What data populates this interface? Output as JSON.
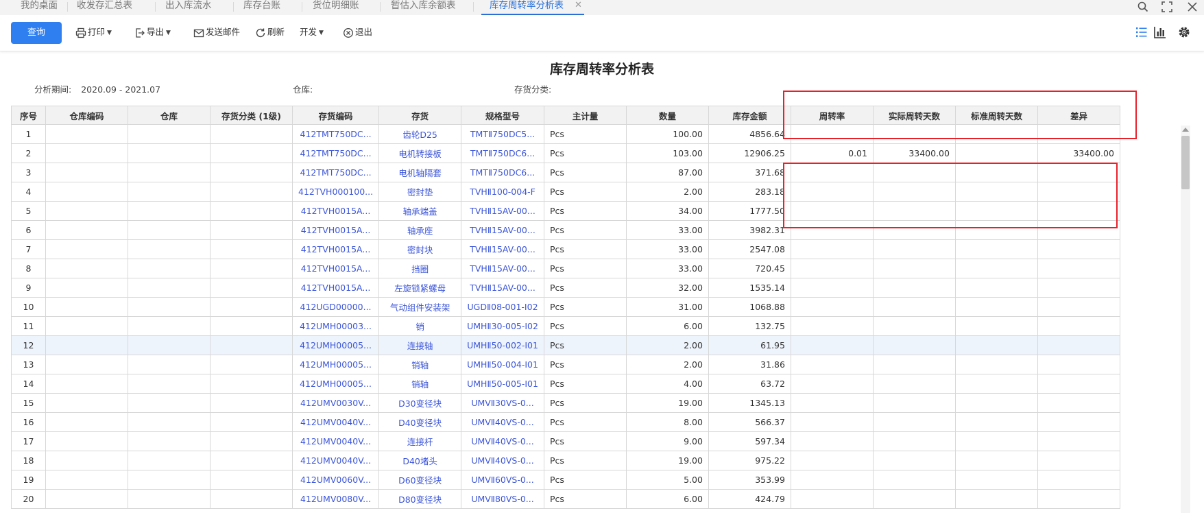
{
  "tabs": [
    {
      "label": "我的桌面"
    },
    {
      "label": "收发存汇总表"
    },
    {
      "label": "出入库流水"
    },
    {
      "label": "库存台账"
    },
    {
      "label": "货位明细账"
    },
    {
      "label": "暂估入库余额表"
    },
    {
      "label": "库存周转率分析表",
      "active": true
    }
  ],
  "toolbar": {
    "query_label": "查询",
    "print_label": "打印",
    "export_label": "导出",
    "mail_label": "发送邮件",
    "refresh_label": "刷新",
    "develop_label": "开发",
    "exit_label": "退出"
  },
  "report": {
    "title": "库存周转率分析表",
    "period_label": "分析期间:",
    "period_value": "2020.09 - 2021.07",
    "warehouse_label": "仓库:",
    "category_label": "存货分类:"
  },
  "table": {
    "columns": [
      "序号",
      "仓库编码",
      "仓库",
      "存货分类 (1级)",
      "存货编码",
      "存货",
      "规格型号",
      "主计量",
      "数量",
      "库存金额",
      "周转率",
      "实际周转天数",
      "标准周转天数",
      "差异"
    ],
    "rows": [
      [
        "1",
        "",
        "",
        "",
        "412TMT750DC...",
        "齿轮D25",
        "TMTⅡ750DC5...",
        "Pcs",
        "100.00",
        "4856.64",
        "",
        "",
        "",
        ""
      ],
      [
        "2",
        "",
        "",
        "",
        "412TMT750DC...",
        "电机转接板",
        "TMTⅡ750DC6...",
        "Pcs",
        "103.00",
        "12906.25",
        "0.01",
        "33400.00",
        "",
        "33400.00"
      ],
      [
        "3",
        "",
        "",
        "",
        "412TMT750DC...",
        "电机轴隔套",
        "TMTⅡ750DC6...",
        "Pcs",
        "87.00",
        "371.68",
        "",
        "",
        "",
        ""
      ],
      [
        "4",
        "",
        "",
        "",
        "412TVH000100...",
        "密封垫",
        "TVHⅡ100-004-F",
        "Pcs",
        "2.00",
        "283.18",
        "",
        "",
        "",
        ""
      ],
      [
        "5",
        "",
        "",
        "",
        "412TVH0015A...",
        "轴承端盖",
        "TVHⅡ15AV-00...",
        "Pcs",
        "34.00",
        "1777.50",
        "",
        "",
        "",
        ""
      ],
      [
        "6",
        "",
        "",
        "",
        "412TVH0015A...",
        "轴承座",
        "TVHⅡ15AV-00...",
        "Pcs",
        "33.00",
        "3982.31",
        "",
        "",
        "",
        ""
      ],
      [
        "7",
        "",
        "",
        "",
        "412TVH0015A...",
        "密封块",
        "TVHⅡ15AV-00...",
        "Pcs",
        "33.00",
        "2547.08",
        "",
        "",
        "",
        ""
      ],
      [
        "8",
        "",
        "",
        "",
        "412TVH0015A...",
        "挡圈",
        "TVHⅡ15AV-00...",
        "Pcs",
        "33.00",
        "720.45",
        "",
        "",
        "",
        ""
      ],
      [
        "9",
        "",
        "",
        "",
        "412TVH0015A...",
        "左旋锁紧螺母",
        "TVHⅡ15AV-00...",
        "Pcs",
        "32.00",
        "1535.14",
        "",
        "",
        "",
        ""
      ],
      [
        "10",
        "",
        "",
        "",
        "412UGD00000...",
        "气动组件安装架",
        "UGDⅡ08-001-I02",
        "Pcs",
        "31.00",
        "1068.88",
        "",
        "",
        "",
        ""
      ],
      [
        "11",
        "",
        "",
        "",
        "412UMH00003...",
        "销",
        "UMHⅡ30-005-I02",
        "Pcs",
        "6.00",
        "132.75",
        "",
        "",
        "",
        ""
      ],
      [
        "12",
        "",
        "",
        "",
        "412UMH00005...",
        "连接轴",
        "UMHⅡ50-002-I01",
        "Pcs",
        "2.00",
        "61.95",
        "",
        "",
        "",
        ""
      ],
      [
        "13",
        "",
        "",
        "",
        "412UMH00005...",
        "销轴",
        "UMHⅡ50-004-I01",
        "Pcs",
        "2.00",
        "31.86",
        "",
        "",
        "",
        ""
      ],
      [
        "14",
        "",
        "",
        "",
        "412UMH00005...",
        "销轴",
        "UMHⅡ50-005-I01",
        "Pcs",
        "4.00",
        "63.72",
        "",
        "",
        "",
        ""
      ],
      [
        "15",
        "",
        "",
        "",
        "412UMV0030V...",
        "D30变径块",
        "UMVⅡ30VS-0...",
        "Pcs",
        "19.00",
        "1345.13",
        "",
        "",
        "",
        ""
      ],
      [
        "16",
        "",
        "",
        "",
        "412UMV0040V...",
        "D40变径块",
        "UMVⅡ40VS-0...",
        "Pcs",
        "8.00",
        "566.37",
        "",
        "",
        "",
        ""
      ],
      [
        "17",
        "",
        "",
        "",
        "412UMV0040V...",
        "连接杆",
        "UMVⅡ40VS-0...",
        "Pcs",
        "9.00",
        "597.34",
        "",
        "",
        "",
        ""
      ],
      [
        "18",
        "",
        "",
        "",
        "412UMV0040V...",
        "D40堵头",
        "UMVⅡ40VS-0...",
        "Pcs",
        "19.00",
        "975.22",
        "",
        "",
        "",
        ""
      ],
      [
        "19",
        "",
        "",
        "",
        "412UMV0060V...",
        "D60变径块",
        "UMVⅡ60VS-0...",
        "Pcs",
        "5.00",
        "353.99",
        "",
        "",
        "",
        ""
      ],
      [
        "20",
        "",
        "",
        "",
        "412UMV0080V...",
        "D80变径块",
        "UMVⅡ80VS-0...",
        "Pcs",
        "6.00",
        "424.79",
        "",
        "",
        "",
        ""
      ]
    ],
    "highlighted_row": 12
  },
  "colors": {
    "accent": "#2f7ff1",
    "link": "#3b55d9",
    "annotation": "#e8202a"
  },
  "icons": [
    "search-icon",
    "fullscreen-icon",
    "close-icon",
    "print-icon",
    "export-icon",
    "mail-icon",
    "refresh-icon",
    "exit-icon",
    "list-view-icon",
    "chart-view-icon",
    "settings-icon"
  ]
}
